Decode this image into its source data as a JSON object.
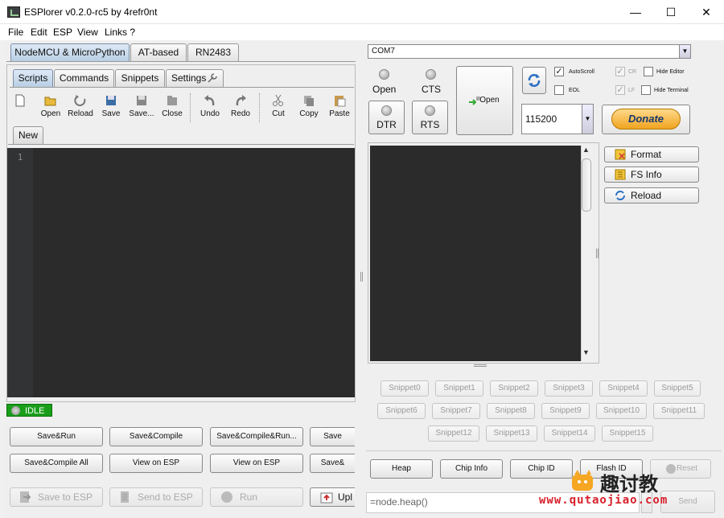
{
  "window": {
    "title": "ESPlorer v0.2.0-rc5 by 4refr0nt",
    "minimize": "—",
    "maximize": "☐",
    "close": "✕"
  },
  "menu": [
    "File",
    "Edit",
    "ESP",
    "View",
    "Links ?"
  ],
  "left": {
    "main_tabs": [
      "NodeMCU & MicroPython",
      "AT-based",
      "RN2483"
    ],
    "sub_tabs": [
      "Scripts",
      "Commands",
      "Snippets",
      "Settings"
    ],
    "toolbar": [
      "Open",
      "Reload",
      "Save",
      "Save...",
      "Close",
      "Undo",
      "Redo",
      "Cut",
      "Copy",
      "Paste"
    ],
    "file_tab": "New",
    "line_number": "1",
    "status": "IDLE",
    "row1": [
      "Save&Run",
      "Save&Compile",
      "Save&Compile&Run...",
      "Save"
    ],
    "row2": [
      "Save&Compile All",
      "View on ESP",
      "View on ESP",
      "Save&"
    ],
    "row3": [
      "Save to ESP",
      "Send to ESP",
      "Run",
      "Upl"
    ]
  },
  "right": {
    "port": "COM7",
    "open_label": "Open",
    "cts_label": "CTS",
    "dtr_label": "DTR",
    "rts_label": "RTS",
    "open_big": "Open",
    "baud": "115200",
    "autoscroll": "AutoScroll",
    "eol": "EOL",
    "cr": "CR",
    "lf": "LF",
    "hide_editor": "Hide Editor",
    "hide_terminal": "Hide Terminal",
    "donate": "Donate",
    "side": [
      "Format",
      "FS Info",
      "Reload"
    ],
    "snippets": [
      "Snippet0",
      "Snippet1",
      "Snippet2",
      "Snippet3",
      "Snippet4",
      "Snippet5",
      "Snippet6",
      "Snippet7",
      "Snippet8",
      "Snippet9",
      "Snippet10",
      "Snippet11",
      "Snippet12",
      "Snippet13",
      "Snippet14",
      "Snippet15"
    ],
    "bottom": [
      "Heap",
      "Chip Info",
      "Chip ID",
      "Flash ID",
      "Reset"
    ],
    "cmd_value": "=node.heap()",
    "send": "Send",
    "arrow": "▼",
    "scroll_up": "▲",
    "scroll_down": "▼"
  },
  "watermark": {
    "text": "趣讨教",
    "url": "www.qutaojiao.com",
    "accent": "#f5a623"
  }
}
